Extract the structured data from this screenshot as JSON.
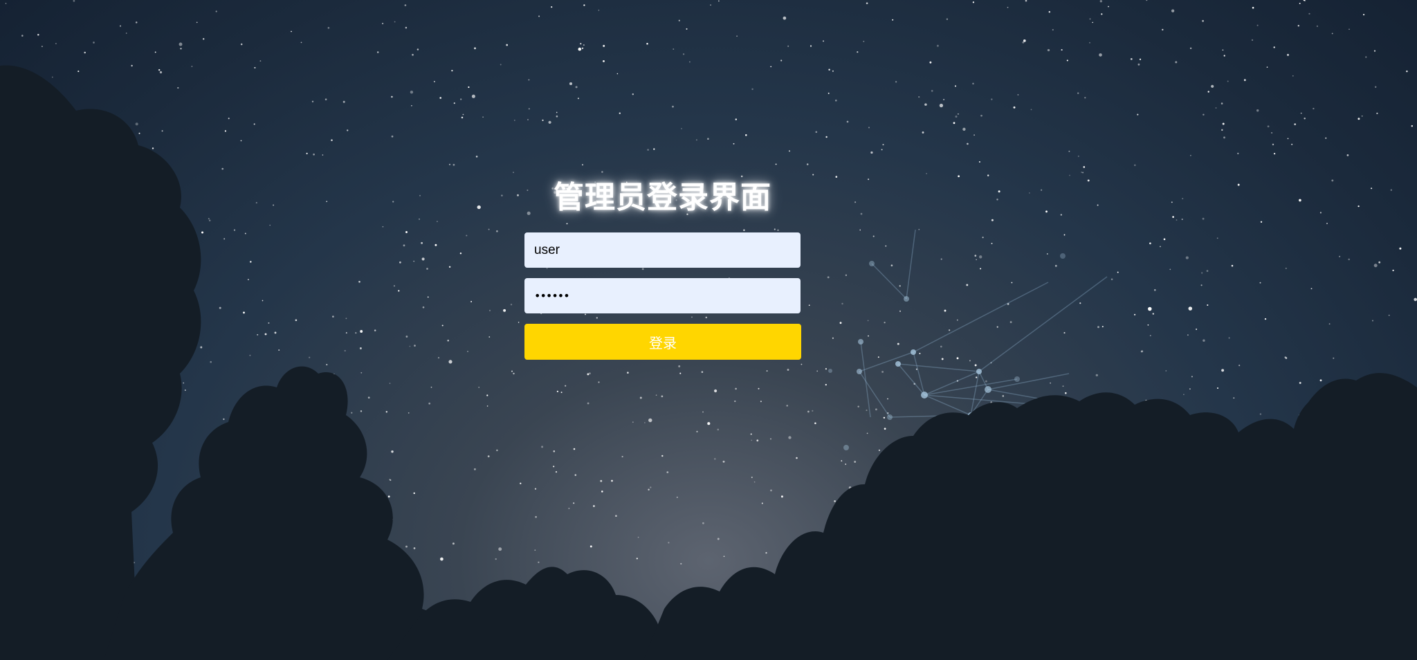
{
  "login": {
    "title": "管理员登录界面",
    "username_value": "user",
    "password_value": "••••••",
    "submit_label": "登录"
  },
  "colors": {
    "submit_button": "#ffd600",
    "input_background": "#e8f0fe",
    "sky": "#1b2a3c",
    "trees": "#141d26",
    "network": "#8fb3cf"
  }
}
